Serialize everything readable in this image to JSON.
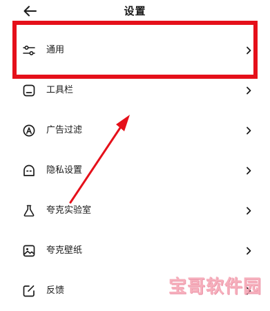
{
  "header": {
    "title": "设置",
    "back_icon": "arrow-left-icon"
  },
  "settings": {
    "items": [
      {
        "label": "通用",
        "icon": "sliders-icon"
      },
      {
        "label": "工具栏",
        "icon": "toolbar-icon"
      },
      {
        "label": "广告过滤",
        "icon": "ad-filter-icon"
      },
      {
        "label": "隐私设置",
        "icon": "privacy-icon"
      },
      {
        "label": "夸克实验室",
        "icon": "flask-icon"
      },
      {
        "label": "夸克壁纸",
        "icon": "wallpaper-icon"
      },
      {
        "label": "反馈",
        "icon": "feedback-icon"
      }
    ],
    "chevron_icon": "chevron-right-icon"
  },
  "annotation": {
    "highlight_color": "#e5101a",
    "arrow_color": "#e5101a"
  },
  "watermark": {
    "text": "宝哥软件园",
    "color": "#f6a7b5"
  }
}
